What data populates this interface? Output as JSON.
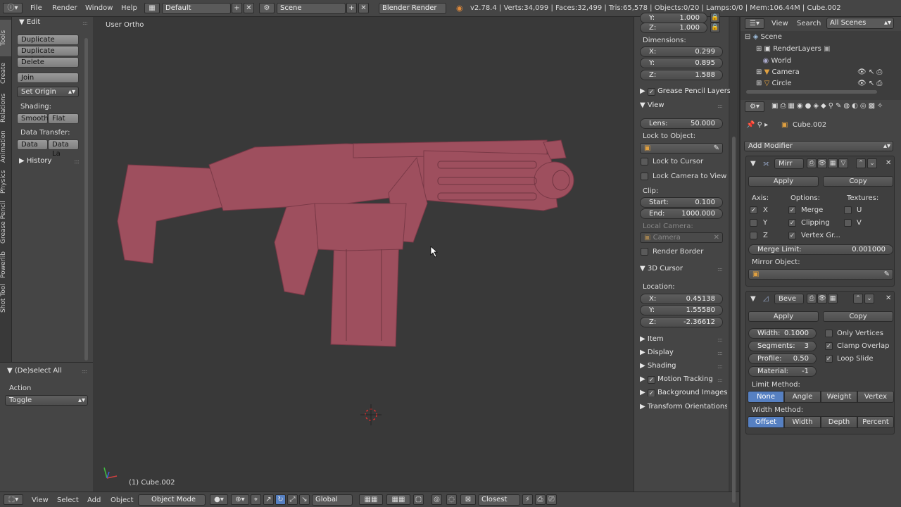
{
  "topbar": {
    "menus": [
      "File",
      "Render",
      "Window",
      "Help"
    ],
    "layout": "Default",
    "scene": "Scene",
    "engine": "Blender Render",
    "stats": "v2.78.4 | Verts:34,099 | Faces:32,499 | Tris:65,578 | Objects:0/20 | Lamps:0/0 | Mem:106.44M | Cube.002"
  },
  "tabs": [
    "Tools",
    "Create",
    "Relations",
    "Animation",
    "Physics",
    "Grease Pencil",
    "Powerlib",
    "Shot Tool"
  ],
  "toolshelf": {
    "edit_header": "Edit",
    "duplicate": "Duplicate",
    "duplicate_linked": "Duplicate Linked",
    "delete": "Delete",
    "join": "Join",
    "set_origin": "Set Origin",
    "shading_label": "Shading:",
    "smooth": "Smooth",
    "flat": "Flat",
    "data_transfer_label": "Data Transfer:",
    "data": "Data",
    "data_layout": "Data La",
    "history": "History"
  },
  "operator": {
    "title": "(De)select All",
    "action_label": "Action",
    "action_value": "Toggle"
  },
  "viewport": {
    "view_name": "User Ortho",
    "object_label": "(1) Cube.002"
  },
  "bottombar": {
    "menus": [
      "View",
      "Select",
      "Add",
      "Object"
    ],
    "mode": "Object Mode",
    "orientation": "Global",
    "snap": "Closest"
  },
  "npanel": {
    "y_top": "Y:",
    "y_top_val": "1.000",
    "z_top": "Z:",
    "z_top_val": "1.000",
    "dimensions": "Dimensions:",
    "dx": "X:",
    "dx_val": "0.299",
    "dy": "Y:",
    "dy_val": "0.895",
    "dz": "Z:",
    "dz_val": "1.588",
    "grease_pencil_layers": "Grease Pencil Layers",
    "view": "View",
    "lens": "Lens:",
    "lens_val": "50.000",
    "lock_to_object": "Lock to Object:",
    "lock_to_cursor": "Lock to Cursor",
    "lock_camera": "Lock Camera to View",
    "clip": "Clip:",
    "start": "Start:",
    "start_val": "0.100",
    "end": "End:",
    "end_val": "1000.000",
    "local_camera": "Local Camera:",
    "camera": "Camera",
    "render_border": "Render Border",
    "cursor3d": "3D Cursor",
    "location": "Location:",
    "cx": "X:",
    "cx_val": "0.45138",
    "cy": "Y:",
    "cy_val": "1.55580",
    "cz": "Z:",
    "cz_val": "-2.36612",
    "item": "Item",
    "display": "Display",
    "shading": "Shading",
    "motion_tracking": "Motion Tracking",
    "background_images": "Background Images",
    "transform_orientations": "Transform Orientations"
  },
  "outliner": {
    "view": "View",
    "search": "Search",
    "filter": "All Scenes",
    "items": [
      "Scene",
      "RenderLayers",
      "World",
      "Camera",
      "Circle"
    ]
  },
  "properties": {
    "object_name": "Cube.002",
    "add_modifier": "Add Modifier",
    "mirror": {
      "name": "Mirr",
      "apply": "Apply",
      "copy": "Copy",
      "axis": "Axis:",
      "options": "Options:",
      "textures": "Textures:",
      "x": "X",
      "y": "Y",
      "z": "Z",
      "merge": "Merge",
      "clipping": "Clipping",
      "vertex_groups": "Vertex Gr...",
      "u": "U",
      "v": "V",
      "merge_limit": "Merge Limit:",
      "merge_limit_val": "0.001000",
      "mirror_object": "Mirror Object:"
    },
    "bevel": {
      "name": "Beve",
      "apply": "Apply",
      "copy": "Copy",
      "width": "Width:",
      "width_val": "0.1000",
      "segments": "Segments:",
      "segments_val": "3",
      "profile": "Profile:",
      "profile_val": "0.50",
      "material": "Material:",
      "material_val": "-1",
      "only_vertices": "Only Vertices",
      "clamp_overlap": "Clamp Overlap",
      "loop_slide": "Loop Slide",
      "limit_method": "Limit Method:",
      "limit_options": [
        "None",
        "Angle",
        "Weight",
        "Vertex Gr..."
      ],
      "width_method": "Width Method:",
      "width_options": [
        "Offset",
        "Width",
        "Depth",
        "Percent"
      ]
    }
  },
  "colors": {
    "model": "#9e4f5e",
    "accent": "#5680c2"
  }
}
